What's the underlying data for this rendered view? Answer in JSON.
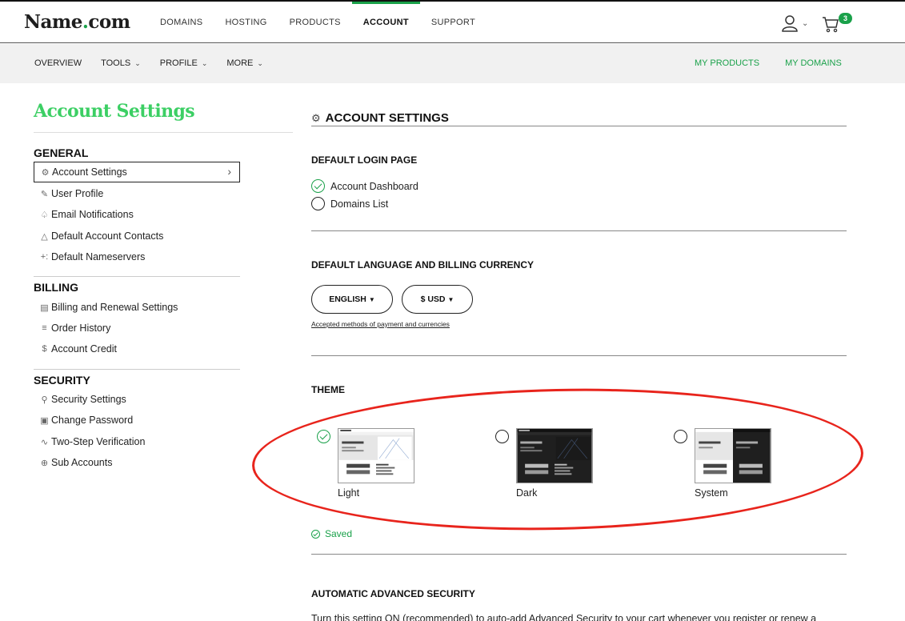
{
  "brand": {
    "name": "Name",
    "dot": ".",
    "tld": "com"
  },
  "topnav": [
    {
      "label": "DOMAINS"
    },
    {
      "label": "HOSTING"
    },
    {
      "label": "PRODUCTS"
    },
    {
      "label": "ACCOUNT",
      "active": true
    },
    {
      "label": "SUPPORT"
    }
  ],
  "cart": {
    "count": "3"
  },
  "subnav": {
    "left": [
      {
        "label": "OVERVIEW",
        "chevron": false
      },
      {
        "label": "TOOLS",
        "chevron": true
      },
      {
        "label": "PROFILE",
        "chevron": true
      },
      {
        "label": "MORE",
        "chevron": true
      }
    ],
    "right": [
      {
        "label": "MY PRODUCTS"
      },
      {
        "label": "MY DOMAINS"
      }
    ]
  },
  "sidebar": {
    "title": "Account Settings",
    "sections": [
      {
        "heading": "GENERAL",
        "items": [
          {
            "label": "Account Settings",
            "icon": "gear-icon",
            "active": true
          },
          {
            "label": "User Profile",
            "icon": "edit-icon"
          },
          {
            "label": "Email Notifications",
            "icon": "bell-icon"
          },
          {
            "label": "Default Account Contacts",
            "icon": "contacts-icon"
          },
          {
            "label": "Default Nameservers",
            "icon": "nameservers-icon"
          }
        ]
      },
      {
        "heading": "BILLING",
        "items": [
          {
            "label": "Billing and Renewal Settings",
            "icon": "billing-icon"
          },
          {
            "label": "Order History",
            "icon": "list-icon"
          },
          {
            "label": "Account Credit",
            "icon": "dollar-icon"
          }
        ]
      },
      {
        "heading": "SECURITY",
        "items": [
          {
            "label": "Security Settings",
            "icon": "key-icon"
          },
          {
            "label": "Change Password",
            "icon": "lock-icon"
          },
          {
            "label": "Two-Step Verification",
            "icon": "two-step-icon"
          },
          {
            "label": "Sub Accounts",
            "icon": "plus-circle-icon"
          }
        ]
      }
    ]
  },
  "main": {
    "heading": "ACCOUNT SETTINGS",
    "login_page": {
      "label": "DEFAULT LOGIN PAGE",
      "options": [
        {
          "label": "Account Dashboard",
          "checked": true
        },
        {
          "label": "Domains List",
          "checked": false
        }
      ]
    },
    "language": {
      "label": "DEFAULT LANGUAGE AND BILLING CURRENCY",
      "language_value": "ENGLISH",
      "currency_value": "$ USD",
      "link": "Accepted methods of payment and currencies"
    },
    "theme": {
      "label": "THEME",
      "options": [
        {
          "label": "Light",
          "checked": true
        },
        {
          "label": "Dark",
          "checked": false
        },
        {
          "label": "System",
          "checked": false
        }
      ],
      "saved": "Saved"
    },
    "security": {
      "label": "AUTOMATIC ADVANCED SECURITY",
      "text": "Turn this setting ON (recommended) to auto-add Advanced Security to your cart whenever you register or renew a"
    }
  },
  "colors": {
    "accent": "#1aa14a",
    "title_green": "#3ccf64",
    "annotation_red": "#e8241c"
  }
}
